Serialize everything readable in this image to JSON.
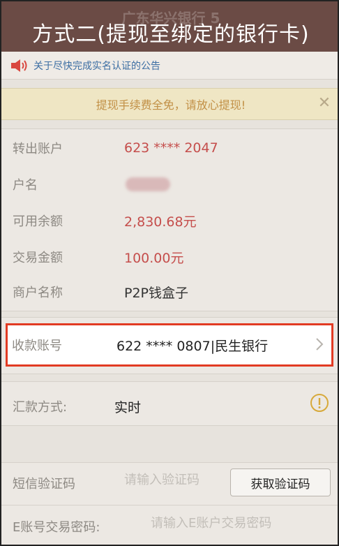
{
  "banner": {
    "background_text": "广东华兴银行 5",
    "title": "方式二(提现至绑定的银行卡)"
  },
  "notice": {
    "icon": "speaker-icon",
    "text": "关于尽快完成实名认证的公告"
  },
  "fee_banner": {
    "text": "提现手续费全免，请放心提现!",
    "close_label": "✕"
  },
  "info": {
    "rows": [
      {
        "label": "转出账户",
        "value": "623 **** 2047"
      },
      {
        "label": "户名",
        "value": ""
      },
      {
        "label": "可用余额",
        "value": "2,830.68元"
      },
      {
        "label": "交易金额",
        "value": "100.00元"
      },
      {
        "label": "商户名称",
        "value": "P2P钱盒子"
      }
    ]
  },
  "payee": {
    "label": "收款账号",
    "value": "622 **** 0807|民生银行"
  },
  "method": {
    "label": "汇款方式:",
    "value": "实时"
  },
  "form": {
    "sms_label": "短信验证码",
    "sms_placeholder": "请输入验证码",
    "sms_button": "获取验证码",
    "pwd_label": "E账号交易密码:",
    "pwd_placeholder": "请输入E账户交易密码"
  },
  "colors": {
    "highlight_border": "#e23b23",
    "value_red": "#c54e4c",
    "notice_blue": "#3c6ea3",
    "fee_text": "#c29046"
  }
}
